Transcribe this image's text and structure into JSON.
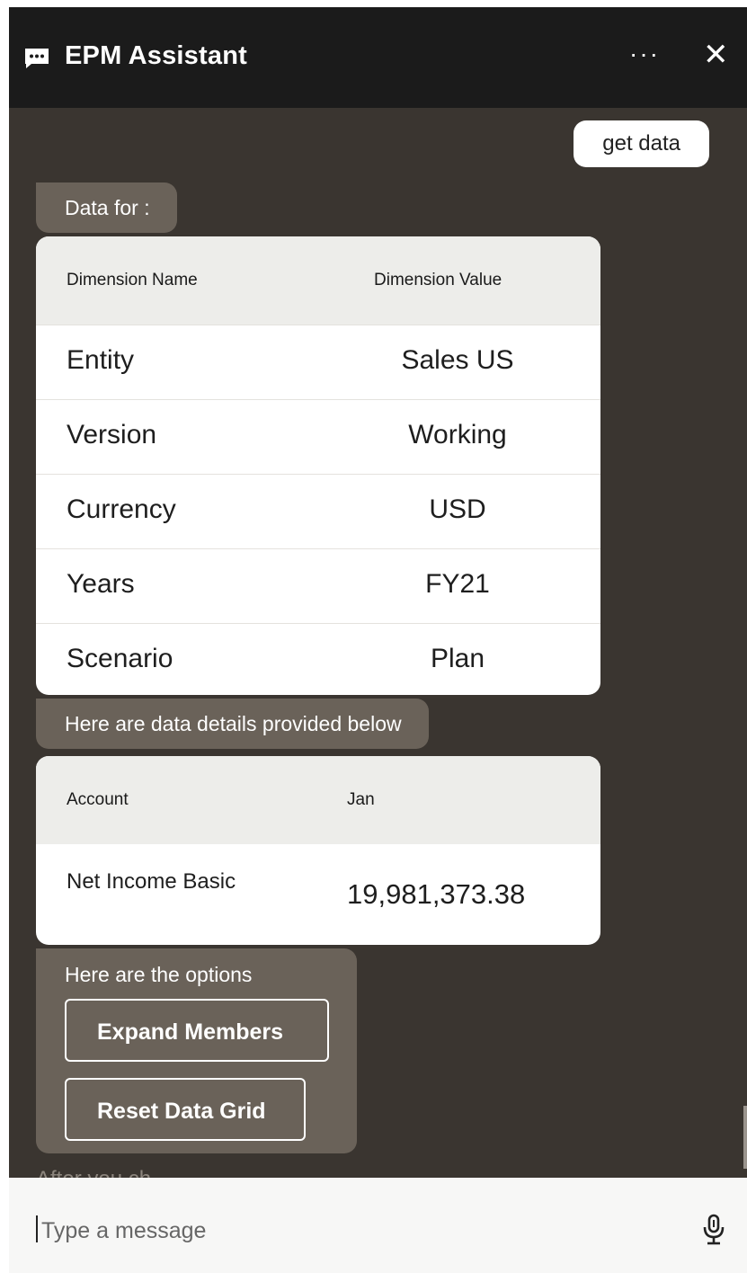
{
  "header": {
    "title": "EPM Assistant",
    "more_label": "···",
    "close_label": "✕",
    "icon": "chat-bubble-icon"
  },
  "chat": {
    "user_message": "get data",
    "data_for_label": "Data for :",
    "dimensions_table": {
      "columns": [
        "Dimension Name",
        "Dimension Value"
      ],
      "rows": [
        [
          "Entity",
          "Sales US"
        ],
        [
          "Version",
          "Working"
        ],
        [
          "Currency",
          "USD"
        ],
        [
          "Years",
          "FY21"
        ],
        [
          "Scenario",
          "Plan"
        ]
      ]
    },
    "details_label": "Here are data details provided below",
    "data_table": {
      "columns": [
        "Account",
        "Jan"
      ],
      "rows": [
        [
          "Net Income Basic",
          "19,981,373.38"
        ]
      ]
    },
    "options_label": "Here are the options",
    "options": [
      "Expand Members",
      "Reset Data Grid"
    ],
    "faded_text": "After you ch"
  },
  "input": {
    "placeholder": "Type a message",
    "mic_icon": "microphone-icon"
  },
  "colors": {
    "header_bg": "#1b1b1b",
    "chat_bg": "#3a3530",
    "bot_bubble_bg": "#6a6259",
    "table_head_bg": "#ededea"
  }
}
